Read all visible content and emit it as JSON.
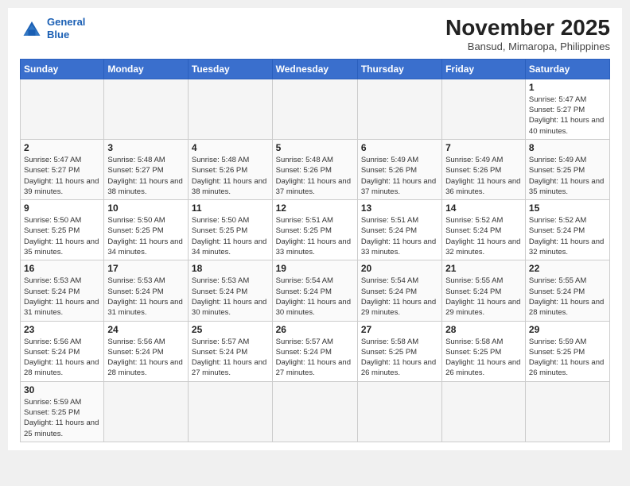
{
  "header": {
    "logo_line1": "General",
    "logo_line2": "Blue",
    "month_title": "November 2025",
    "subtitle": "Bansud, Mimaropa, Philippines"
  },
  "weekdays": [
    "Sunday",
    "Monday",
    "Tuesday",
    "Wednesday",
    "Thursday",
    "Friday",
    "Saturday"
  ],
  "weeks": [
    [
      null,
      null,
      null,
      null,
      null,
      null,
      {
        "day": "1",
        "sunrise": "5:47 AM",
        "sunset": "5:27 PM",
        "daylight": "11 hours and 40 minutes."
      }
    ],
    [
      {
        "day": "2",
        "sunrise": "5:47 AM",
        "sunset": "5:27 PM",
        "daylight": "11 hours and 39 minutes."
      },
      {
        "day": "3",
        "sunrise": "5:48 AM",
        "sunset": "5:27 PM",
        "daylight": "11 hours and 38 minutes."
      },
      {
        "day": "4",
        "sunrise": "5:48 AM",
        "sunset": "5:26 PM",
        "daylight": "11 hours and 38 minutes."
      },
      {
        "day": "5",
        "sunrise": "5:48 AM",
        "sunset": "5:26 PM",
        "daylight": "11 hours and 37 minutes."
      },
      {
        "day": "6",
        "sunrise": "5:49 AM",
        "sunset": "5:26 PM",
        "daylight": "11 hours and 37 minutes."
      },
      {
        "day": "7",
        "sunrise": "5:49 AM",
        "sunset": "5:26 PM",
        "daylight": "11 hours and 36 minutes."
      },
      {
        "day": "8",
        "sunrise": "5:49 AM",
        "sunset": "5:25 PM",
        "daylight": "11 hours and 35 minutes."
      }
    ],
    [
      {
        "day": "9",
        "sunrise": "5:50 AM",
        "sunset": "5:25 PM",
        "daylight": "11 hours and 35 minutes."
      },
      {
        "day": "10",
        "sunrise": "5:50 AM",
        "sunset": "5:25 PM",
        "daylight": "11 hours and 34 minutes."
      },
      {
        "day": "11",
        "sunrise": "5:50 AM",
        "sunset": "5:25 PM",
        "daylight": "11 hours and 34 minutes."
      },
      {
        "day": "12",
        "sunrise": "5:51 AM",
        "sunset": "5:25 PM",
        "daylight": "11 hours and 33 minutes."
      },
      {
        "day": "13",
        "sunrise": "5:51 AM",
        "sunset": "5:24 PM",
        "daylight": "11 hours and 33 minutes."
      },
      {
        "day": "14",
        "sunrise": "5:52 AM",
        "sunset": "5:24 PM",
        "daylight": "11 hours and 32 minutes."
      },
      {
        "day": "15",
        "sunrise": "5:52 AM",
        "sunset": "5:24 PM",
        "daylight": "11 hours and 32 minutes."
      }
    ],
    [
      {
        "day": "16",
        "sunrise": "5:53 AM",
        "sunset": "5:24 PM",
        "daylight": "11 hours and 31 minutes."
      },
      {
        "day": "17",
        "sunrise": "5:53 AM",
        "sunset": "5:24 PM",
        "daylight": "11 hours and 31 minutes."
      },
      {
        "day": "18",
        "sunrise": "5:53 AM",
        "sunset": "5:24 PM",
        "daylight": "11 hours and 30 minutes."
      },
      {
        "day": "19",
        "sunrise": "5:54 AM",
        "sunset": "5:24 PM",
        "daylight": "11 hours and 30 minutes."
      },
      {
        "day": "20",
        "sunrise": "5:54 AM",
        "sunset": "5:24 PM",
        "daylight": "11 hours and 29 minutes."
      },
      {
        "day": "21",
        "sunrise": "5:55 AM",
        "sunset": "5:24 PM",
        "daylight": "11 hours and 29 minutes."
      },
      {
        "day": "22",
        "sunrise": "5:55 AM",
        "sunset": "5:24 PM",
        "daylight": "11 hours and 28 minutes."
      }
    ],
    [
      {
        "day": "23",
        "sunrise": "5:56 AM",
        "sunset": "5:24 PM",
        "daylight": "11 hours and 28 minutes."
      },
      {
        "day": "24",
        "sunrise": "5:56 AM",
        "sunset": "5:24 PM",
        "daylight": "11 hours and 28 minutes."
      },
      {
        "day": "25",
        "sunrise": "5:57 AM",
        "sunset": "5:24 PM",
        "daylight": "11 hours and 27 minutes."
      },
      {
        "day": "26",
        "sunrise": "5:57 AM",
        "sunset": "5:24 PM",
        "daylight": "11 hours and 27 minutes."
      },
      {
        "day": "27",
        "sunrise": "5:58 AM",
        "sunset": "5:25 PM",
        "daylight": "11 hours and 26 minutes."
      },
      {
        "day": "28",
        "sunrise": "5:58 AM",
        "sunset": "5:25 PM",
        "daylight": "11 hours and 26 minutes."
      },
      {
        "day": "29",
        "sunrise": "5:59 AM",
        "sunset": "5:25 PM",
        "daylight": "11 hours and 26 minutes."
      }
    ],
    [
      {
        "day": "30",
        "sunrise": "5:59 AM",
        "sunset": "5:25 PM",
        "daylight": "11 hours and 25 minutes."
      },
      null,
      null,
      null,
      null,
      null,
      null
    ]
  ]
}
